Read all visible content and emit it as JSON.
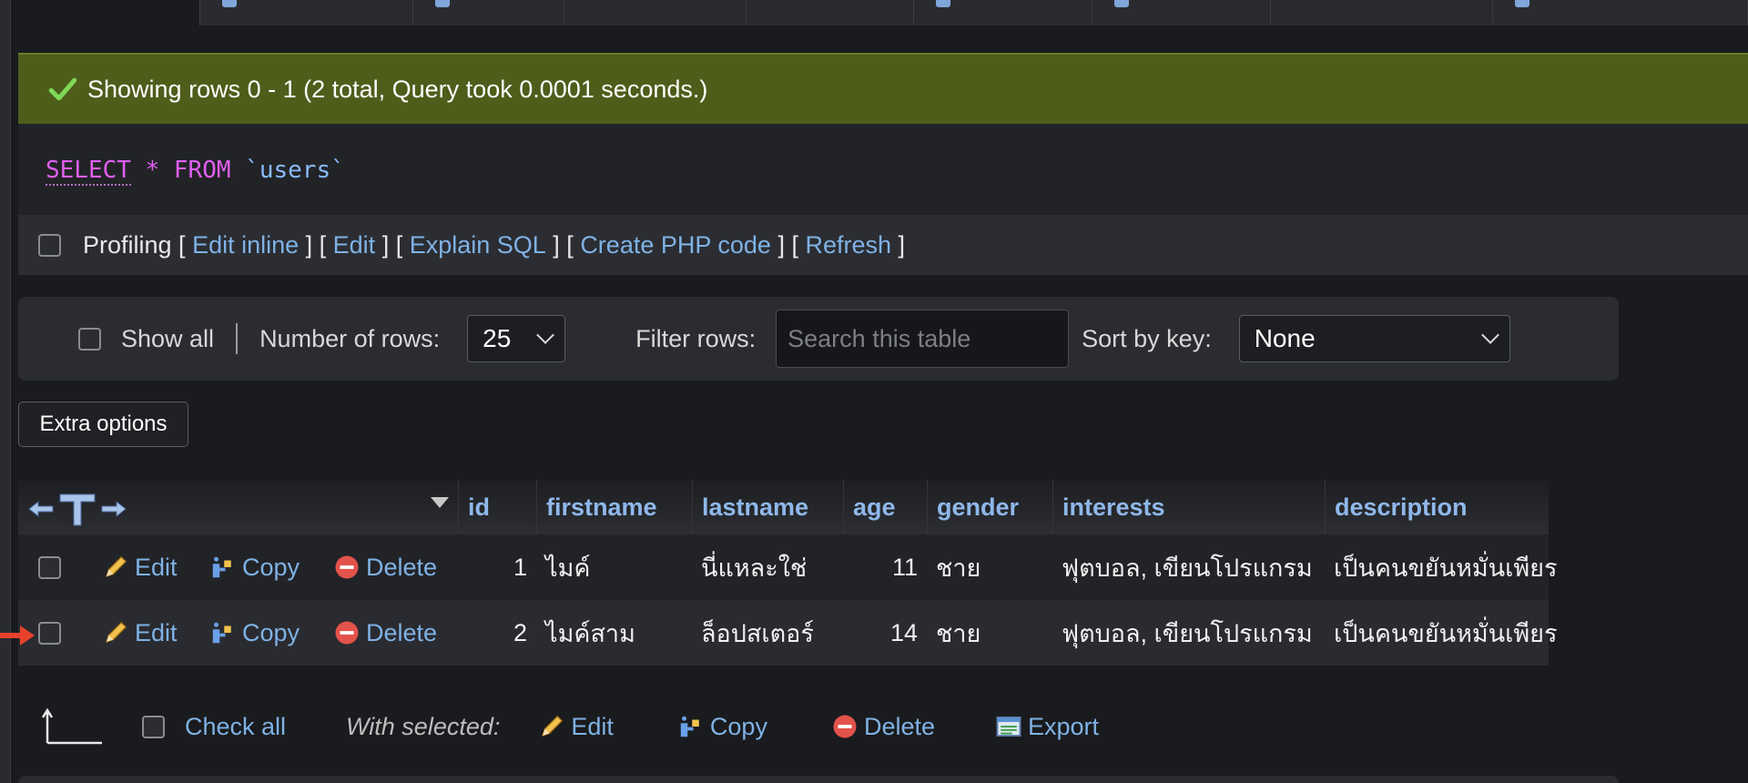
{
  "status": {
    "message": "Showing rows 0 - 1 (2 total, Query took 0.0001 seconds.)",
    "color": "#4f5d1b"
  },
  "sql": {
    "keyword_select": "SELECT",
    "star": "*",
    "keyword_from": "FROM",
    "table": "`users`"
  },
  "profiling": {
    "label": "Profiling",
    "open": " [ ",
    "sep": " ] [ ",
    "close": " ]",
    "links": [
      "Edit inline",
      "Edit",
      "Explain SQL",
      "Create PHP code",
      "Refresh"
    ]
  },
  "navigation": {
    "show_all": "Show all",
    "rows_label": "Number of rows:",
    "rows_value": "25",
    "filter_label": "Filter rows:",
    "filter_placeholder": "Search this table",
    "sort_label": "Sort by key:",
    "sort_value": "None"
  },
  "extra_options": "Extra options",
  "columns": [
    "id",
    "firstname",
    "lastname",
    "age",
    "gender",
    "interests",
    "description"
  ],
  "row_actions": {
    "edit": "Edit",
    "copy": "Copy",
    "delete": "Delete"
  },
  "rows": [
    {
      "id": "1",
      "firstname": "ไมค์",
      "lastname": "นี่แหละใช่",
      "age": "11",
      "gender": "ชาย",
      "interests": "ฟุตบอล, เขียนโปรแกรม",
      "description": "เป็นคนขยันหมั่นเพียร"
    },
    {
      "id": "2",
      "firstname": "ไมค์สาม",
      "lastname": "ล็อปสเตอร์",
      "age": "14",
      "gender": "ชาย",
      "interests": "ฟุตบอล, เขียนโปรแกรม",
      "description": "เป็นคนขยันหมั่นเพียร"
    }
  ],
  "footer": {
    "check_all": "Check all",
    "with_selected": "With selected:",
    "edit": "Edit",
    "copy": "Copy",
    "delete": "Delete",
    "export": "Export"
  },
  "colors": {
    "link": "#7fb2e5",
    "header": "#8fb8ea",
    "keyword": "#e05ff0",
    "arrow": "#e8422c"
  }
}
